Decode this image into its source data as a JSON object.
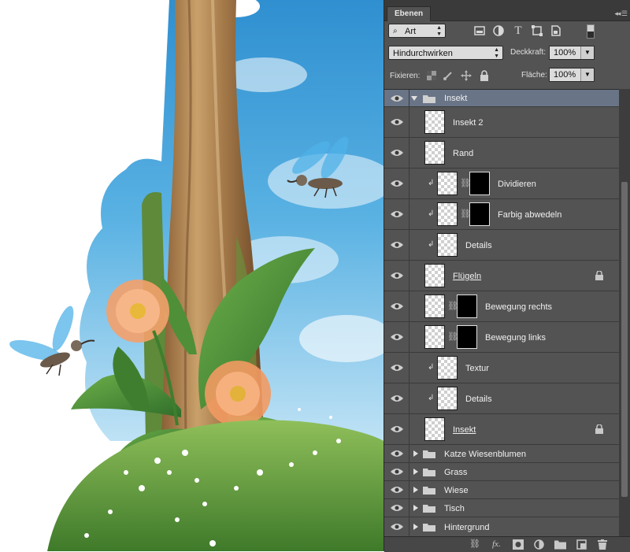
{
  "panel": {
    "tab_label": "Ebenen",
    "filter_kind": "Art",
    "blend_mode": "Hindurchwirken",
    "opacity_label": "Deckkraft:",
    "opacity_value": "100%",
    "lock_label": "Fixieren:",
    "fill_label": "Fläche:",
    "fill_value": "100%"
  },
  "layers": [
    {
      "name": "Insekt",
      "type": "group",
      "expanded": true,
      "selected": true,
      "indent": 0
    },
    {
      "name": "Insekt 2",
      "type": "layer",
      "indent": 1
    },
    {
      "name": "Rand",
      "type": "layer",
      "indent": 1
    },
    {
      "name": "Dividieren",
      "type": "layer",
      "indent": 2,
      "clipped": true,
      "mask": true
    },
    {
      "name": "Farbig abwedeln",
      "type": "layer",
      "indent": 2,
      "clipped": true,
      "mask": true
    },
    {
      "name": "Details",
      "type": "layer",
      "indent": 2,
      "clipped": true
    },
    {
      "name": "Flügeln",
      "type": "layer",
      "indent": 1,
      "underline": true,
      "locked": true
    },
    {
      "name": "Bewegung rechts",
      "type": "layer",
      "indent": 1,
      "mask": true
    },
    {
      "name": "Bewegung links",
      "type": "layer",
      "indent": 1,
      "mask": true
    },
    {
      "name": "Textur",
      "type": "layer",
      "indent": 2,
      "clipped": true
    },
    {
      "name": "Details",
      "type": "layer",
      "indent": 2,
      "clipped": true
    },
    {
      "name": "Insekt",
      "type": "layer",
      "indent": 1,
      "underline": true,
      "locked": true
    },
    {
      "name": "Katze Wiesenblumen",
      "type": "group",
      "expanded": false
    },
    {
      "name": "Grass",
      "type": "group",
      "expanded": false
    },
    {
      "name": "Wiese",
      "type": "group",
      "expanded": false
    },
    {
      "name": "Tisch",
      "type": "group",
      "expanded": false
    },
    {
      "name": "Hintergrund",
      "type": "group",
      "expanded": false
    }
  ],
  "bottom_icons": [
    "link-icon",
    "fx-icon",
    "mask-icon",
    "adjustment-icon",
    "folder-icon",
    "new-layer-icon",
    "trash-icon"
  ],
  "colors": {
    "panel_bg": "#535353",
    "selected_row": "#697486",
    "sky_blue": "#4aa6dc"
  }
}
